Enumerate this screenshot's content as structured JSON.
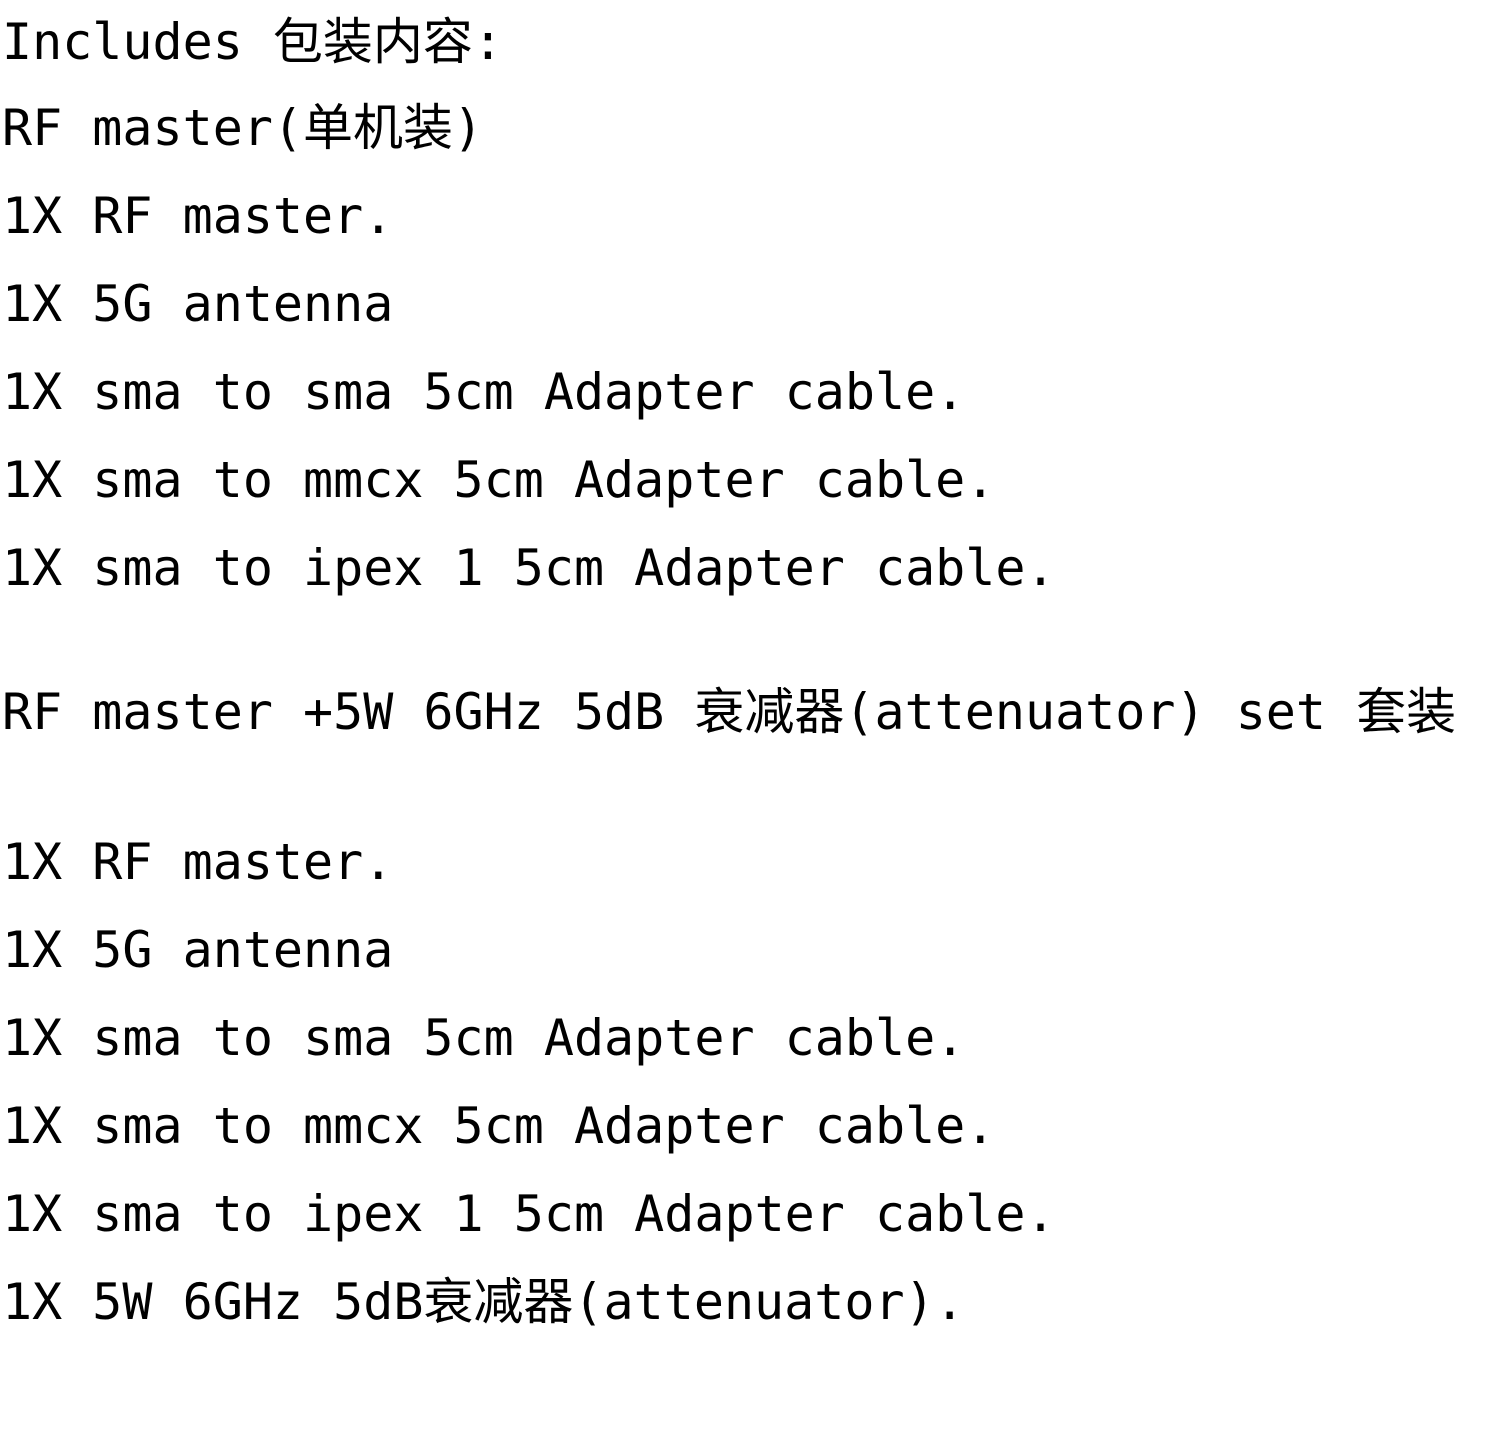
{
  "document": {
    "title": "Includes 包装内容:",
    "background_color": "#ffffff",
    "text_color": "#000000"
  },
  "header": {
    "text": "Includes 包装内容:"
  },
  "sections": [
    {
      "id": "rf-master-single",
      "heading": "RF master(单机装)",
      "items": [
        "1X RF master.",
        "1X 5G antenna",
        "1X sma to sma 5cm Adapter cable.",
        "1X sma to mmcx 5cm Adapter cable.",
        "1X sma to ipex 1 5cm Adapter cable."
      ]
    },
    {
      "id": "rf-master-attenuator-set",
      "heading": "RF master +5W 6GHz 5dB 衰减器(attenuator) set 套装",
      "items": [
        "1X RF master.",
        "1X 5G antenna",
        "1X sma to sma 5cm Adapter cable.",
        "1X sma to mmcx 5cm Adapter cable.",
        "1X sma to ipex 1 5cm Adapter cable.",
        "1X 5W 6GHz 5dB衰减器(attenuator)."
      ]
    }
  ]
}
